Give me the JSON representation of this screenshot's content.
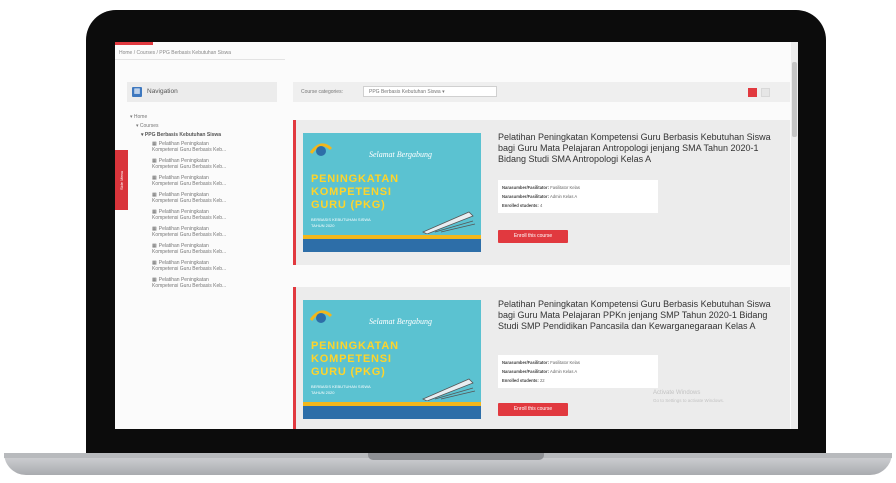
{
  "breadcrumb": "Home / Courses / PPG Berbasis Kebutuhan Siswa",
  "side_tab": "Side Menu",
  "navigation": {
    "title": "Navigation",
    "home": "Home",
    "courses": "Courses",
    "category": "PPG Berbasis Kebutuhan Siswa",
    "items": [
      {
        "line1": "Pelatihan Peningkatan",
        "line2": "Kompetensi Guru Berbasis Keb..."
      },
      {
        "line1": "Pelatihan Peningkatan",
        "line2": "Kompetensi Guru Berbasis Keb..."
      },
      {
        "line1": "Pelatihan Peningkatan",
        "line2": "Kompetensi Guru Berbasis Keb..."
      },
      {
        "line1": "Pelatihan Peningkatan",
        "line2": "Kompetensi Guru Berbasis Keb..."
      },
      {
        "line1": "Pelatihan Peningkatan",
        "line2": "Kompetensi Guru Berbasis Keb..."
      },
      {
        "line1": "Pelatihan Peningkatan",
        "line2": "Kompetensi Guru Berbasis Keb..."
      },
      {
        "line1": "Pelatihan Peningkatan",
        "line2": "Kompetensi Guru Berbasis Keb..."
      },
      {
        "line1": "Pelatihan Peningkatan",
        "line2": "Kompetensi Guru Berbasis Keb..."
      },
      {
        "line1": "Pelatihan Peningkatan",
        "line2": "Kompetensi Guru Berbasis Keb..."
      }
    ]
  },
  "category_bar": {
    "label": "Course categories:",
    "selected": "PPG Berbasis Kebutuhan Siswa"
  },
  "banner": {
    "welcome": "Selamat Bergabung",
    "line1": "PENINGKATAN",
    "line2": "KOMPETENSI",
    "line3": "GURU (PKG)",
    "small1": "BERBASIS KEBUTUHAN SISWA",
    "small2": "TAHUN 2020"
  },
  "courses": [
    {
      "title": "Pelatihan Peningkatan Kompetensi Guru Berbasis Kebutuhan Siswa bagi Guru Mata Pelajaran Antropologi jenjang SMA Tahun 2020-1 Bidang Studi SMA Antropologi Kelas A",
      "facilitator1_label": "Narasumber/Fasilitator:",
      "facilitator1": "Fasilitator Kelas",
      "facilitator2_label": "Narasumber/Fasilitator:",
      "facilitator2": "Admin Kelas A",
      "enrolled_label": "Enrolled students:",
      "enrolled": "4",
      "button": "Enroll this course"
    },
    {
      "title": "Pelatihan Peningkatan Kompetensi Guru Berbasis Kebutuhan Siswa bagi Guru Mata Pelajaran PPKn jenjang SMP Tahun 2020-1 Bidang Studi SMP Pendidikan Pancasila dan Kewarganegaraan Kelas A",
      "facilitator1_label": "Narasumber/Fasilitator:",
      "facilitator1": "Fasilitator Kelas",
      "facilitator2_label": "Narasumber/Fasilitator:",
      "facilitator2": "Admin Kelas A",
      "enrolled_label": "Enrolled students:",
      "enrolled": "22",
      "button": "Enroll this course"
    }
  ],
  "watermark": {
    "line1": "Activate Windows",
    "line2": "Go to Settings to activate Windows."
  },
  "colors": {
    "accent": "#e1393f",
    "banner": "#5bc2d1",
    "nav_icon": "#3e78bf"
  }
}
